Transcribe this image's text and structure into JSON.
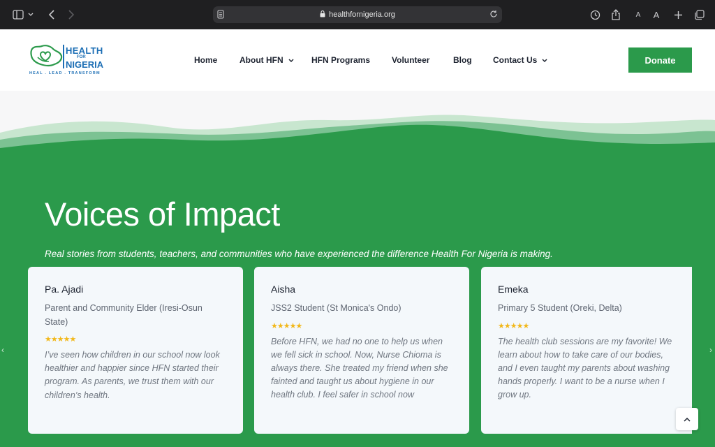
{
  "browser": {
    "url": "healthfornigeria.org"
  },
  "site": {
    "logo": {
      "health": "HEALTH",
      "for": "FOR",
      "nigeria": "NIGERIA",
      "tagline": "HEAL . LEAD . TRANSFORM"
    },
    "nav": [
      {
        "label": "Home",
        "has_dropdown": false
      },
      {
        "label": "About HFN",
        "has_dropdown": true
      },
      {
        "label": "HFN Programs",
        "has_dropdown": false
      },
      {
        "label": "Volunteer",
        "has_dropdown": false
      },
      {
        "label": "Blog",
        "has_dropdown": false
      },
      {
        "label": "Contact Us",
        "has_dropdown": true
      }
    ],
    "donate_label": "Donate"
  },
  "hero": {
    "title": "Voices of Impact",
    "subtitle": "Real stories from students, teachers, and communities who have experienced the difference Health For Nigeria is making."
  },
  "testimonials": [
    {
      "name": "Pa. Ajadi",
      "role": "Parent and Community Elder (Iresi-Osun State)",
      "rating": 5,
      "stars": "★★★★★",
      "quote": "I’ve seen how children in our school now look healthier and happier since HFN started their program. As parents, we trust them with our children’s health."
    },
    {
      "name": "Aisha",
      "role": "JSS2 Student (St Monica's Ondo)",
      "rating": 5,
      "stars": "★★★★★",
      "quote": "Before HFN, we had no one to help us when we fell sick in school. Now, Nurse Chioma is always there. She treated my friend when she fainted and taught us about hygiene in our health club. I feel safer in school now"
    },
    {
      "name": "Emeka",
      "role": "Primary 5 Student (Oreki, Delta)",
      "rating": 5,
      "stars": "★★★★★",
      "quote": "The health club sessions are my favorite! We learn about how to take care of our bodies, and I even taught my parents about washing hands properly. I want to be a nurse when I grow up."
    }
  ],
  "colors": {
    "brand_green": "#2b9a4b",
    "brand_blue": "#1d6fb5",
    "star": "#f2b81b",
    "chrome": "#1f1f21"
  }
}
